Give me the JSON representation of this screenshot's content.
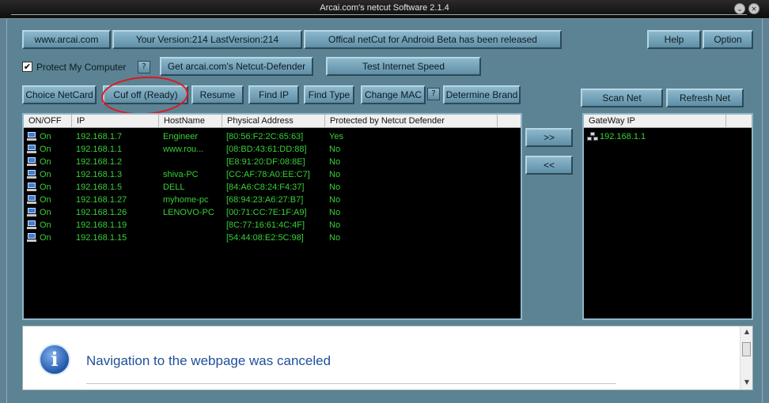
{
  "window": {
    "title": "Arcai.com's netcut Software 2.1.4"
  },
  "toolbar_top": {
    "site": "www.arcai.com",
    "version": "Your Version:214 LastVersion:214",
    "android": "Offical netCut for Android Beta has been released",
    "help": "Help",
    "option": "Option"
  },
  "toolbar_mid": {
    "protect_checked": true,
    "check_mark": "✔",
    "protect_label": "Protect My Computer",
    "help_q": "?",
    "defender": "Get arcai.com's Netcut-Defender",
    "speed": "Test Internet Speed"
  },
  "toolbar_actions": {
    "choice": "Choice NetCard",
    "cutoff": "Cuf off (Ready)",
    "resume": "Resume",
    "findip": "Find IP",
    "findtype": "Find Type",
    "changemac": "Change MAC",
    "q": "?",
    "brand": "Determine Brand",
    "scan": "Scan Net",
    "refresh": "Refresh Net"
  },
  "arrows": {
    "forward": ">>",
    "back": "<<"
  },
  "table": {
    "columns": [
      "ON/OFF",
      "IP",
      "HostName",
      "Physical Address",
      "Protected by Netcut Defender"
    ],
    "rows": [
      [
        "On",
        "192.168.1.7",
        "Engineer",
        "[80:56:F2:2C:65:63]",
        "Yes"
      ],
      [
        "On",
        "192.168.1.1",
        "www.rou...",
        "[08:BD:43:61:DD:88]",
        "No"
      ],
      [
        "On",
        "192.168.1.2",
        "",
        "[E8:91:20:DF:08:8E]",
        "No"
      ],
      [
        "On",
        "192.168.1.3",
        "shiva-PC",
        "[CC:AF:78:A0:EE:C7]",
        "No"
      ],
      [
        "On",
        "192.168.1.5",
        "DELL",
        "[84:A6:C8:24:F4:37]",
        "No"
      ],
      [
        "On",
        "192.168.1.27",
        "myhome-pc",
        "[68:94:23:A6:27:B7]",
        "No"
      ],
      [
        "On",
        "192.168.1.26",
        "LENOVO-PC",
        "[00:71:CC:7E:1F:A9]",
        "No"
      ],
      [
        "On",
        "192.168.1.19",
        "",
        "[8C:77:16:61:4C:4F]",
        "No"
      ],
      [
        "On",
        "192.168.1.15",
        "",
        "[54:44:08:E2:5C:98]",
        "No"
      ]
    ]
  },
  "gateway": {
    "header": "GateWay IP",
    "ip": "192.168.1.1"
  },
  "browser": {
    "message": "Navigation to the webpage was canceled",
    "info_glyph": "i"
  }
}
